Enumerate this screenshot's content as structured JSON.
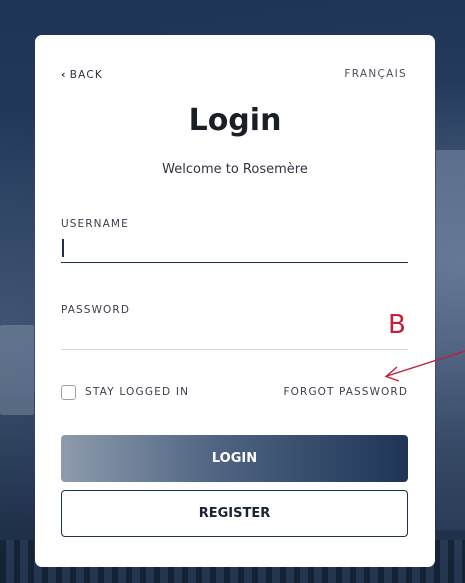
{
  "nav": {
    "back_label": "BACK",
    "language_label": "FRANÇAIS"
  },
  "header": {
    "title": "Login",
    "subtitle": "Welcome to Rosemère"
  },
  "form": {
    "username_label": "USERNAME",
    "username_value": "",
    "password_label": "PASSWORD",
    "password_value": "",
    "stay_logged_in_label": "STAY LOGGED IN",
    "stay_logged_in_checked": false,
    "forgot_password_label": "FORGOT PASSWORD"
  },
  "buttons": {
    "login_label": "LOGIN",
    "register_label": "REGISTER"
  },
  "annotation": {
    "letter": "B",
    "color": "#c41e3a"
  },
  "colors": {
    "primary_navy": "#1e2f4f",
    "annotation_red": "#c41e3a"
  },
  "icons": {
    "back": "chevron-left-icon",
    "annotation_arrow": "arrow-icon"
  }
}
